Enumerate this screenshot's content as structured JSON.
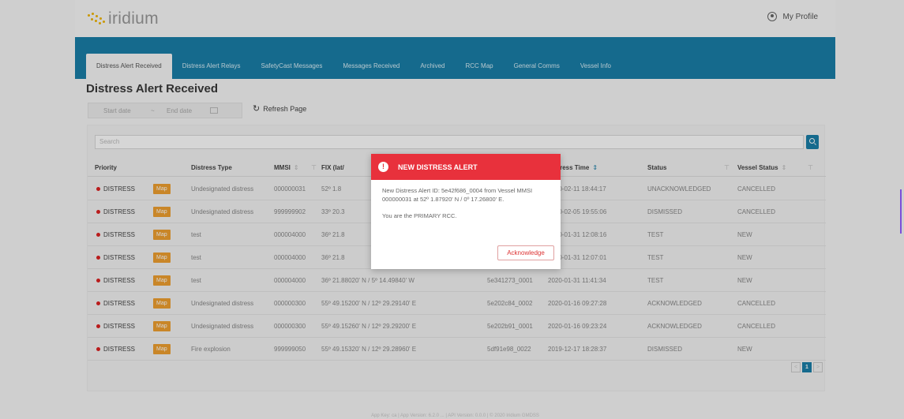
{
  "header": {
    "logo_text": "iridium",
    "profile_label": "My Profile"
  },
  "nav": {
    "tabs": [
      {
        "label": "Distress Alert Received",
        "active": true
      },
      {
        "label": "Distress Alert Relays"
      },
      {
        "label": "SafetyCast Messages"
      },
      {
        "label": "Messages Received"
      },
      {
        "label": "Archived"
      },
      {
        "label": "RCC Map"
      },
      {
        "label": "General Comms"
      },
      {
        "label": "Vessel Info"
      }
    ]
  },
  "page": {
    "title": "Distress Alert Received",
    "start_date_placeholder": "Start date",
    "date_separator": "~",
    "end_date_placeholder": "End date",
    "refresh_label": "Refresh Page",
    "search_placeholder": "Search"
  },
  "table": {
    "headers": {
      "priority": "Priority",
      "distress_type": "Distress Type",
      "mmsi": "MMSI",
      "fix": "FIX (lat/",
      "alert_id": "",
      "distress_time": "Distress Time",
      "status": "Status",
      "vessel_status": "Vessel Status"
    },
    "map_label": "Map",
    "rows": [
      {
        "priority": "DISTRESS",
        "type": "Undesignated distress",
        "mmsi": "000000031",
        "fix": "52º 1.8",
        "alert_id": "",
        "time": "2020-02-11 18:44:17",
        "status": "UNACKNOWLEDGED",
        "vessel_status": "CANCELLED"
      },
      {
        "priority": "DISTRESS",
        "type": "Undesignated distress",
        "mmsi": "999999902",
        "fix": "33º 20.3",
        "alert_id": "",
        "time": "2020-02-05 19:55:06",
        "status": "DISMISSED",
        "vessel_status": "CANCELLED"
      },
      {
        "priority": "DISTRESS",
        "type": "test",
        "mmsi": "000004000",
        "fix": "36º 21.8",
        "alert_id": "",
        "time": "2020-01-31 12:08:16",
        "status": "TEST",
        "vessel_status": "NEW"
      },
      {
        "priority": "DISTRESS",
        "type": "test",
        "mmsi": "000004000",
        "fix": "36º 21.8",
        "alert_id": "",
        "time": "2020-01-31 12:07:01",
        "status": "TEST",
        "vessel_status": "NEW"
      },
      {
        "priority": "DISTRESS",
        "type": "test",
        "mmsi": "000004000",
        "fix": "36º 21.88020' N / 5º 14.49840' W",
        "alert_id": "5e341273_0001",
        "time": "2020-01-31 11:41:34",
        "status": "TEST",
        "vessel_status": "NEW"
      },
      {
        "priority": "DISTRESS",
        "type": "Undesignated distress",
        "mmsi": "000000300",
        "fix": "55º 49.15200' N / 12º 29.29140' E",
        "alert_id": "5e202c84_0002",
        "time": "2020-01-16 09:27:28",
        "status": "ACKNOWLEDGED",
        "vessel_status": "CANCELLED"
      },
      {
        "priority": "DISTRESS",
        "type": "Undesignated distress",
        "mmsi": "000000300",
        "fix": "55º 49.15260' N / 12º 29.29200' E",
        "alert_id": "5e202b91_0001",
        "time": "2020-01-16 09:23:24",
        "status": "ACKNOWLEDGED",
        "vessel_status": "CANCELLED"
      },
      {
        "priority": "DISTRESS",
        "type": "Fire explosion",
        "mmsi": "999999050",
        "fix": "55º 49.15320' N / 12º 29.28960' E",
        "alert_id": "5df91e98_0022",
        "time": "2019-12-17 18:28:37",
        "status": "DISMISSED",
        "vessel_status": "NEW"
      }
    ]
  },
  "pagination": {
    "prev": "<",
    "current": "1",
    "next": ">"
  },
  "footer": {
    "text": "App Key: ca | App Version: 6.2.0 ... | API Version: 0.0.0 | © 2020 Iridium GMDSS"
  },
  "modal": {
    "title": "NEW DISTRESS ALERT",
    "warning_glyph": "!",
    "message": "New Distress Alert ID: 5e42f686_0004 from Vessel MMSI 000000031 at 52º 1.87920' N / 0º 17.26800' E.",
    "role_message": "You are the PRIMARY RCC.",
    "ack_label": "Acknowledge"
  },
  "colors": {
    "nav_blue": "#1a7fa8",
    "alert_red": "#e8313c",
    "map_orange": "#f0a030",
    "logo_yellow": "#f0b400"
  }
}
